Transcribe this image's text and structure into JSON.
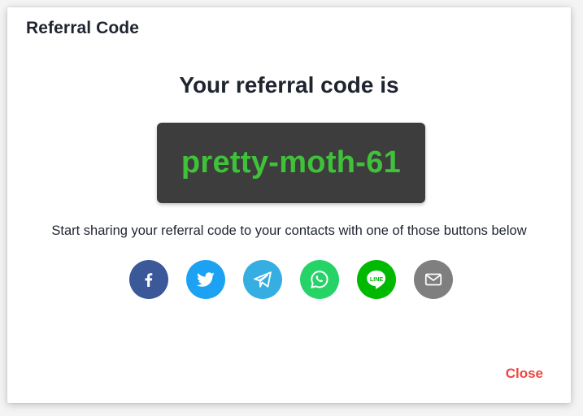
{
  "dialog": {
    "title": "Referral Code",
    "headline": "Your referral code is",
    "code": "pretty-moth-61",
    "description": "Start sharing your referral code to your contacts with one of those buttons below",
    "close_label": "Close"
  },
  "share_buttons": [
    {
      "name": "facebook",
      "icon": "facebook-icon",
      "color": "#3b5998"
    },
    {
      "name": "twitter",
      "icon": "twitter-icon",
      "color": "#1da1f2"
    },
    {
      "name": "telegram",
      "icon": "telegram-icon",
      "color": "#37aee2"
    },
    {
      "name": "whatsapp",
      "icon": "whatsapp-icon",
      "color": "#25d366"
    },
    {
      "name": "line",
      "icon": "line-icon",
      "color": "#00b900",
      "label": "LINE"
    },
    {
      "name": "email",
      "icon": "email-icon",
      "color": "#7f7f7f"
    }
  ],
  "colors": {
    "code_text": "#3fc23a",
    "code_background": "#3d3d3d",
    "close_text": "#f2453d"
  }
}
